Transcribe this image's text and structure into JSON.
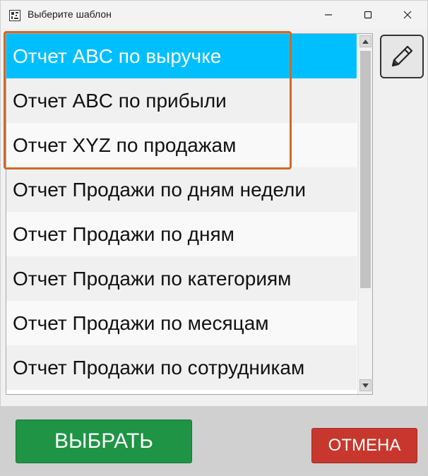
{
  "window": {
    "title": "Выберите шаблон",
    "icon": "app-icon",
    "controls": [
      "minimize-icon",
      "maximize-icon",
      "close-icon"
    ]
  },
  "templates": {
    "items": [
      {
        "label": "Отчет ABC по выручке",
        "selected": true
      },
      {
        "label": "Отчет ABC по прибыли",
        "selected": false
      },
      {
        "label": "Отчет XYZ по продажам",
        "selected": false
      },
      {
        "label": "Отчет Продажи по дням недели",
        "selected": false
      },
      {
        "label": "Отчет Продажи по дням",
        "selected": false
      },
      {
        "label": "Отчет Продажи по категориям",
        "selected": false
      },
      {
        "label": "Отчет Продажи по месяцам",
        "selected": false
      },
      {
        "label": "Отчет Продажи по сотрудникам",
        "selected": false
      }
    ]
  },
  "toolbar": {
    "edit_icon": "pencil-icon"
  },
  "buttons": {
    "select_label": "ВЫБРАТЬ",
    "cancel_label": "ОТМЕНА"
  },
  "colors": {
    "selection": "#00bfff",
    "highlight_border": "#cd6a28",
    "select_button": "#1e9444",
    "cancel_button": "#c8372d"
  }
}
